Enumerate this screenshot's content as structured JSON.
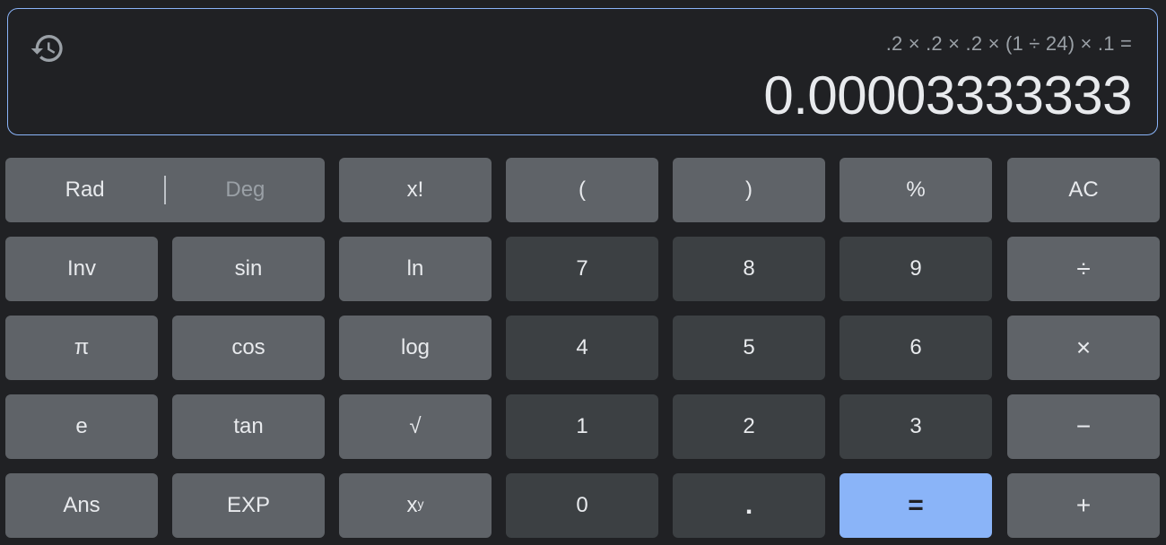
{
  "display": {
    "history_icon": "history-icon",
    "expression": ".2 × .2 × .2 × (1 ÷ 24) × .1 =",
    "result": "0.00003333333"
  },
  "angle_mode": {
    "options": [
      "Rad",
      "Deg"
    ],
    "selected": "Rad"
  },
  "keys": {
    "factorial": "x!",
    "open_paren": "(",
    "close_paren": ")",
    "percent": "%",
    "clear": "AC",
    "inv": "Inv",
    "sin": "sin",
    "ln": "ln",
    "seven": "7",
    "eight": "8",
    "nine": "9",
    "divide": "÷",
    "pi": "π",
    "cos": "cos",
    "log": "log",
    "four": "4",
    "five": "5",
    "six": "6",
    "multiply": "×",
    "e": "e",
    "tan": "tan",
    "sqrt": "√",
    "one": "1",
    "two": "2",
    "three": "3",
    "subtract": "−",
    "ans": "Ans",
    "exp": "EXP",
    "power_base": "x",
    "power_exp": "y",
    "zero": "0",
    "decimal": ".",
    "equals": "=",
    "add": "+"
  },
  "colors": {
    "background": "#202124",
    "function_key": "#5f6368",
    "digit_key": "#3c4043",
    "accent": "#8ab4f8",
    "text": "#e8eaed",
    "muted_text": "#9aa0a6"
  }
}
